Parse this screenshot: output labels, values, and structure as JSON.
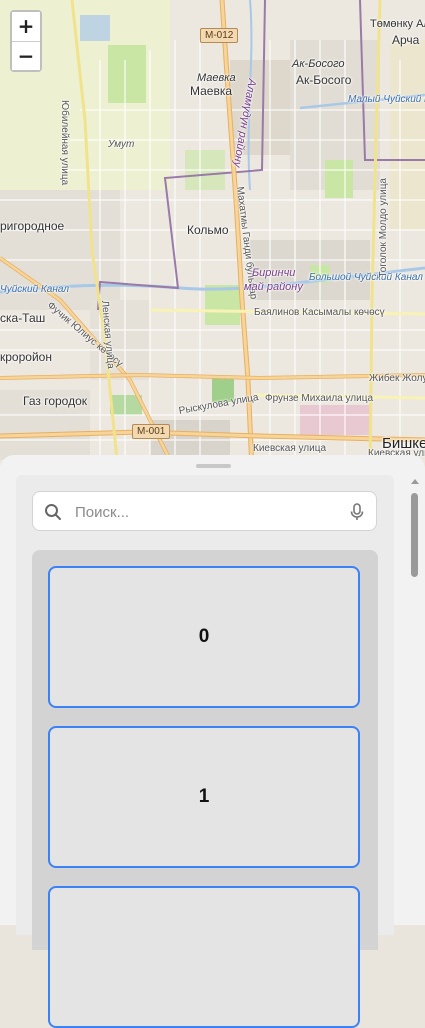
{
  "map": {
    "zoom_in_label": "+",
    "zoom_out_label": "−",
    "labels": [
      {
        "text": "Төмөнку Ала",
        "cls": "small"
      },
      {
        "text": "Арча",
        "cls": ""
      },
      {
        "text": "Маевка",
        "cls": "italic small"
      },
      {
        "text": "Маевка",
        "cls": ""
      },
      {
        "text": "Ак-Босого",
        "cls": "italic"
      },
      {
        "text": "Ак-Босого",
        "cls": ""
      },
      {
        "text": "Малый Чуйский канал",
        "cls": "water"
      },
      {
        "text": "Умут",
        "cls": "small italic"
      },
      {
        "text": "Юбилейная улица",
        "cls": "small"
      },
      {
        "text": "Аламүдүн району",
        "cls": "district"
      },
      {
        "text": "Махатмы Ганди бульвар",
        "cls": "small"
      },
      {
        "text": "Кольмо",
        "cls": ""
      },
      {
        "text": "ригородное",
        "cls": ""
      },
      {
        "text": "Биринчи",
        "cls": "district"
      },
      {
        "text": "май району",
        "cls": "district"
      },
      {
        "text": "Большой Чуйский Канал",
        "cls": "water"
      },
      {
        "text": "Чуйский Канал",
        "cls": "water"
      },
      {
        "text": "Баялинов Касымалы көчөсү",
        "cls": "small"
      },
      {
        "text": "ска-Таш",
        "cls": ""
      },
      {
        "text": "Фучик Юлиус көчөсү",
        "cls": "small"
      },
      {
        "text": "Ленская улица",
        "cls": "small"
      },
      {
        "text": "Тоголок Молдо улица",
        "cls": "small"
      },
      {
        "text": "кроройон",
        "cls": ""
      },
      {
        "text": "Жибек Жолу пр.",
        "cls": "small"
      },
      {
        "text": "Газ городок",
        "cls": ""
      },
      {
        "text": "Фрунзе Михаила улица",
        "cls": "small"
      },
      {
        "text": "Рыскулова улица",
        "cls": "small"
      },
      {
        "text": "Бишке",
        "cls": "big"
      },
      {
        "text": "Киевская улица",
        "cls": "small"
      },
      {
        "text": "Киевская улица",
        "cls": "small"
      }
    ],
    "shields": [
      "M-012",
      "M-001"
    ]
  },
  "sheet": {
    "search": {
      "placeholder": "Поиск...",
      "value": ""
    },
    "items": [
      {
        "label": "0"
      },
      {
        "label": "1"
      },
      {
        "label": ""
      }
    ]
  },
  "colors": {
    "accent": "#3b82f6",
    "card_bg": "#e4e4e4",
    "list_bg": "#d3d3d3",
    "sheet_bg": "#f2f2f2"
  }
}
